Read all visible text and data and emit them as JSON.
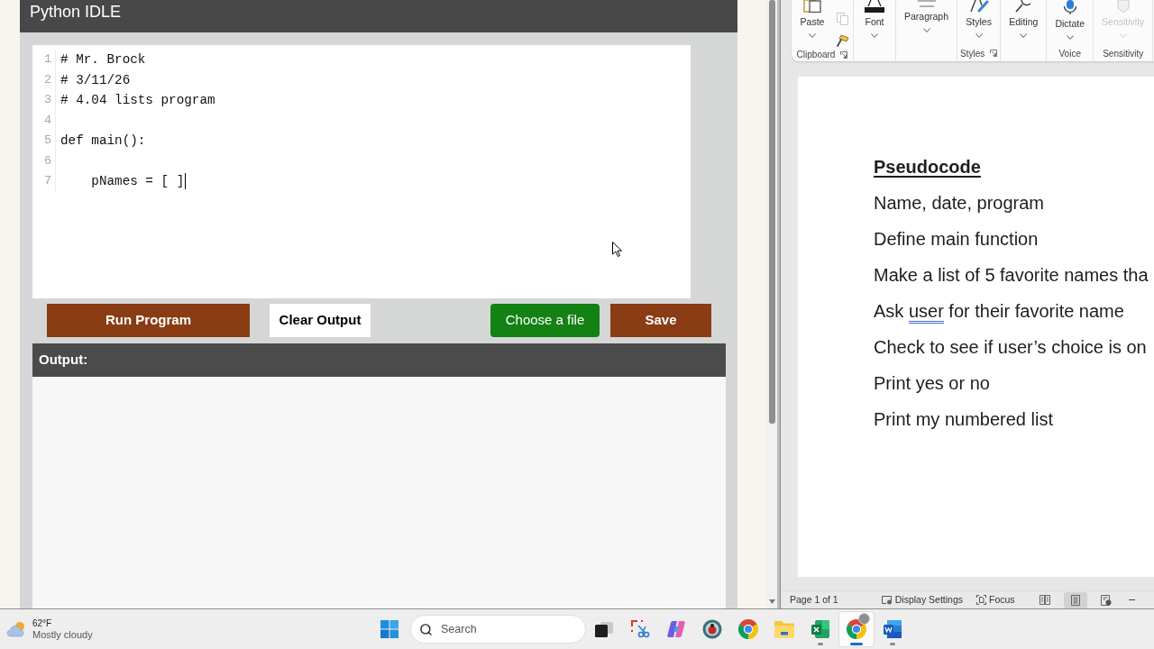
{
  "browser": {
    "idle": {
      "title": "Python IDLE",
      "editor": {
        "lines": [
          {
            "number": "1",
            "code": "# Mr. Brock",
            "caret": false
          },
          {
            "number": "2",
            "code": "# 3/11/26",
            "caret": false
          },
          {
            "number": "3",
            "code": "# 4.04 lists program",
            "caret": false
          },
          {
            "number": "4",
            "caret": false
          },
          {
            "number": "5",
            "code": "def main():",
            "caret": false
          },
          {
            "number": "6",
            "caret": false
          },
          {
            "number": "7",
            "code": "    pNames = [ ]",
            "caret": true
          }
        ]
      },
      "buttons": [
        {
          "label": "Run Program",
          "kind": "run"
        },
        {
          "label": "Clear Output",
          "kind": "clear"
        },
        {
          "label": "Choose a file",
          "kind": "file"
        },
        {
          "label": "Save",
          "kind": "save"
        }
      ],
      "output": {
        "label": "Output:"
      }
    }
  },
  "word": {
    "ribbon": {
      "groups": [
        {
          "label": "Clipboard",
          "launcher": true,
          "buttons": [
            {
              "label": "Paste",
              "kind": "paste",
              "disabled": false
            },
            {
              "kind": "copy",
              "disabled": true
            },
            {
              "kind": "painter",
              "disabled": false
            }
          ]
        },
        {
          "launcher": false,
          "buttons": [
            {
              "label": "Font",
              "kind": "font",
              "disabled": false
            }
          ]
        },
        {
          "launcher": false,
          "buttons": [
            {
              "label": "Paragraph",
              "kind": "paragraph",
              "disabled": false
            }
          ]
        },
        {
          "label": "Styles",
          "launcher": true,
          "buttons": [
            {
              "label": "Styles",
              "kind": "styles",
              "disabled": false
            }
          ]
        },
        {
          "launcher": false,
          "buttons": [
            {
              "label": "Editing",
              "kind": "editing",
              "disabled": false
            }
          ]
        },
        {
          "label": "Voice",
          "launcher": false,
          "buttons": [
            {
              "label": "Dictate",
              "kind": "dictate",
              "disabled": false
            }
          ]
        },
        {
          "label": "Sensitivity",
          "launcher": false,
          "buttons": [
            {
              "label": "Sensitivity",
              "kind": "sensitivity",
              "disabled": true
            }
          ]
        }
      ]
    },
    "document": {
      "paragraphs": [
        {
          "kind": "heading",
          "runs": [
            {
              "text": "Pseudocode",
              "flagged": false
            }
          ]
        },
        {
          "kind": "body",
          "runs": [
            {
              "text": "Name, date, program",
              "flagged": false
            }
          ]
        },
        {
          "kind": "body",
          "runs": [
            {
              "text": "Define main function",
              "flagged": false
            }
          ]
        },
        {
          "kind": "body",
          "runs": [
            {
              "text": "Make a list of 5 favorite names tha",
              "flagged": false
            }
          ]
        },
        {
          "kind": "body",
          "runs": [
            {
              "text": "Ask ",
              "flagged": false
            },
            {
              "text": "user",
              "flagged": true
            },
            {
              "text": " for their favorite name",
              "flagged": false
            }
          ]
        },
        {
          "kind": "body",
          "runs": [
            {
              "text": "Check to see if user’s choice is on",
              "flagged": false
            }
          ]
        },
        {
          "kind": "body",
          "runs": [
            {
              "text": "Print yes or no",
              "flagged": false
            }
          ]
        },
        {
          "kind": "body",
          "runs": [
            {
              "text": "Print my numbered list",
              "flagged": false
            }
          ]
        }
      ]
    },
    "status_bar": {
      "page": "Page 1 of 1",
      "display_settings": "Display Settings",
      "focus": "Focus",
      "views": [
        {
          "kind": "read",
          "selected": false
        },
        {
          "kind": "print",
          "selected": true
        },
        {
          "kind": "web",
          "selected": false
        }
      ]
    }
  },
  "taskbar": {
    "weather": {
      "temperature": "62°F",
      "condition": "Mostly cloudy"
    },
    "search": {
      "placeholder": "Search"
    },
    "apps": [
      {
        "kind": "taskview",
        "running": false,
        "selected": false,
        "profile_badge": false
      },
      {
        "kind": "snip",
        "running": false,
        "selected": false,
        "profile_badge": false
      },
      {
        "kind": "copilot",
        "running": false,
        "selected": false,
        "profile_badge": false
      },
      {
        "kind": "bug",
        "running": false,
        "selected": false,
        "profile_badge": false
      },
      {
        "kind": "chrome",
        "running": false,
        "selected": false,
        "profile_badge": false
      },
      {
        "kind": "folder",
        "running": false,
        "selected": false,
        "profile_badge": false
      },
      {
        "kind": "excel",
        "running": true,
        "selected": false,
        "profile_badge": false
      },
      {
        "kind": "chrome",
        "running": true,
        "selected": true,
        "profile_badge": true
      },
      {
        "kind": "word",
        "running": true,
        "selected": false,
        "profile_badge": false
      }
    ]
  }
}
